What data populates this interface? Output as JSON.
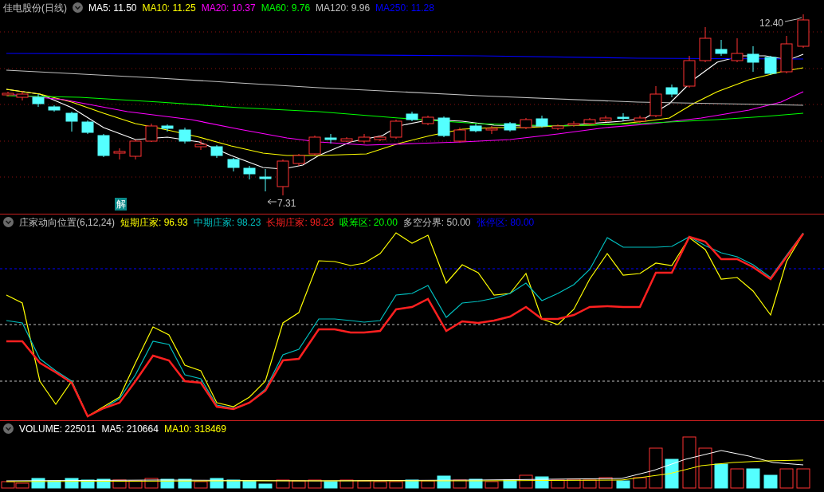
{
  "main_panel": {
    "title": "佳电股份(日线)",
    "indicators": [
      {
        "label": "MA5: 11.50",
        "color": "#ffffff"
      },
      {
        "label": "MA10: 11.25",
        "color": "#ffff00"
      },
      {
        "label": "MA20: 10.37",
        "color": "#ff00ff"
      },
      {
        "label": "MA60: 9.76",
        "color": "#00ff00"
      },
      {
        "label": "MA120: 9.96",
        "color": "#c0c0c0"
      },
      {
        "label": "MA250: 11.28",
        "color": "#0000ff"
      }
    ],
    "high_label": "12.40",
    "low_label": "7.31",
    "marker": "解"
  },
  "indicator_panel": {
    "title": "庄家动向位置(6,12,24)",
    "indicators": [
      {
        "label": "短期庄家: 96.93",
        "color": "#ffff00"
      },
      {
        "label": "中期庄家: 98.23",
        "color": "#00c0c0"
      },
      {
        "label": "长期庄家: 98.23",
        "color": "#ff2020"
      },
      {
        "label": "吸筹区: 20.00",
        "color": "#00ff00"
      },
      {
        "label": "多空分界: 50.00",
        "color": "#c0c0c0"
      },
      {
        "label": "张停区: 80.00",
        "color": "#0000ff"
      }
    ]
  },
  "volume_panel": {
    "indicators": [
      {
        "label": "VOLUME: 225011",
        "color": "#ffffff"
      },
      {
        "label": "MA5: 210664",
        "color": "#ffffff"
      },
      {
        "label": "MA10: 318469",
        "color": "#ffff00"
      }
    ]
  }
}
